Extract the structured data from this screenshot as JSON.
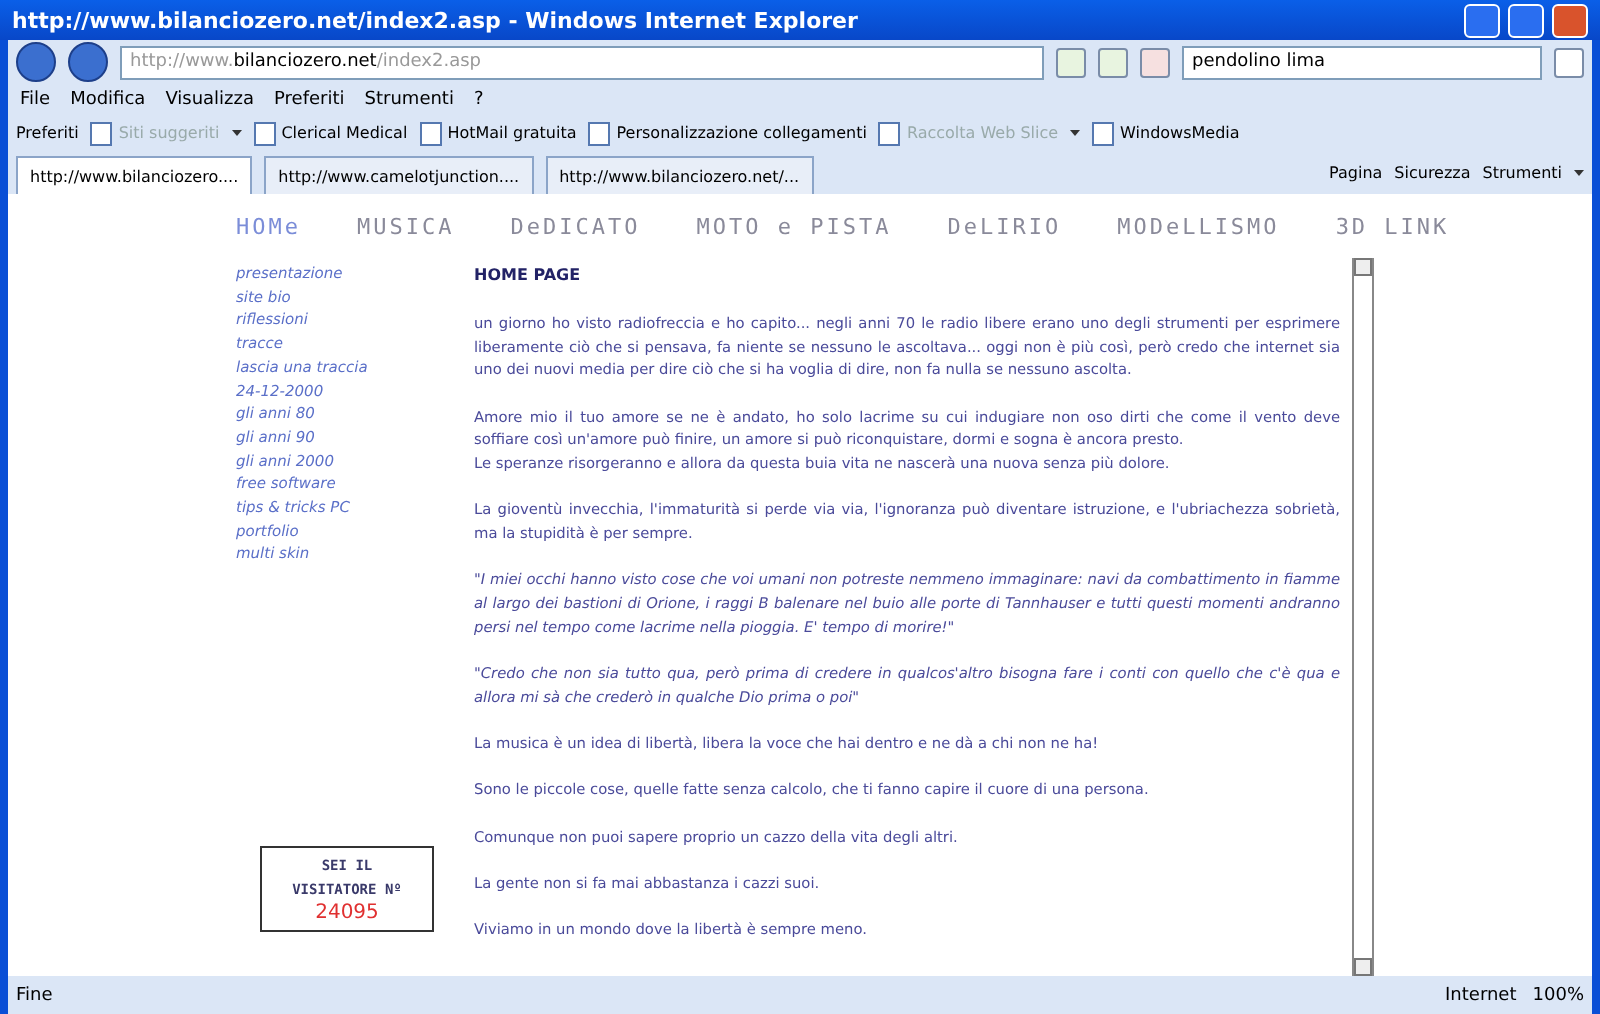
{
  "window": {
    "title": "http://www.bilanciozero.net/index2.asp - Windows Internet Explorer"
  },
  "address_bar": {
    "prefix": "http://www.",
    "domain": "bilanciozero.net",
    "path": "/index2.asp"
  },
  "search": {
    "value": "pendolino lima"
  },
  "menu": [
    "File",
    "Modifica",
    "Visualizza",
    "Preferiti",
    "Strumenti",
    "?"
  ],
  "favorites_bar": {
    "label": "Preferiti",
    "links": [
      {
        "label": "Siti suggeriti",
        "disabled": true,
        "dropdown": true
      },
      {
        "label": "Clerical Medical",
        "disabled": false,
        "dropdown": false
      },
      {
        "label": "HotMail gratuita",
        "disabled": false,
        "dropdown": false
      },
      {
        "label": "Personalizzazione collegamenti",
        "disabled": false,
        "dropdown": false
      },
      {
        "label": "Raccolta Web Slice",
        "disabled": true,
        "dropdown": true
      },
      {
        "label": "WindowsMedia",
        "disabled": false,
        "dropdown": false
      }
    ]
  },
  "tabs": [
    {
      "label": "http://www.bilanciozero....",
      "selected": true
    },
    {
      "label": "http://www.camelotjunction....",
      "selected": false
    },
    {
      "label": "http://www.bilanciozero.net/...",
      "selected": false
    }
  ],
  "command_bar": [
    "Pagina",
    "Sicurezza",
    "Strumenti"
  ],
  "page": {
    "nav": [
      {
        "label": "HOMe",
        "selected": true
      },
      {
        "label": "MUSICA",
        "selected": false
      },
      {
        "label": "DeDICATO",
        "selected": false
      },
      {
        "label": "MOTO e PISTA",
        "selected": false
      },
      {
        "label": "DeLIRIO",
        "selected": false
      },
      {
        "label": "MODeLLISMO",
        "selected": false
      },
      {
        "label": "3D LINK",
        "selected": false
      }
    ],
    "side_menu": [
      "presentazione",
      "site bio",
      "riflessioni",
      "tracce",
      "lascia una traccia",
      "24-12-2000",
      "gli anni 80",
      "gli anni 90",
      "gli anni 2000",
      "free software",
      "tips & tricks PC",
      "portfolio",
      "multi skin"
    ],
    "counter": {
      "label": "SEI IL VISITATORE Nº",
      "value": "24095"
    },
    "heading": "HOME PAGE",
    "paragraphs": [
      {
        "text": "un giorno ho visto radiofreccia e ho capito... negli anni 70 le radio libere erano uno degli strumenti per esprimere liberamente ciò che si pensava, fa niente se nessuno le ascoltava... oggi non è più così, però credo che internet sia uno dei nuovi media per dire ciò che si ha voglia di dire, non fa nulla se nessuno ascolta.",
        "italic": false
      },
      {
        "text": "Amore mio il tuo amore se ne è andato, ho solo lacrime su cui indugiare non oso dirti che come il vento deve soffiare così un'amore può finire, un amore si può riconquistare, dormi e sogna è ancora presto.",
        "italic": false
      },
      {
        "text": "Le speranze risorgeranno e allora da questa buia vita ne nascerà una nuova senza più dolore.",
        "italic": false
      },
      {
        "text": "La gioventù invecchia, l'immaturità si perde via via, l'ignoranza può diventare istruzione, e l'ubriachezza sobrietà, ma la stupidità è per sempre.",
        "italic": false
      },
      {
        "text": "\"I miei occhi hanno visto cose che voi umani non potreste nemmeno immaginare: navi da combattimento in fiamme al largo dei bastioni di Orione, i raggi B balenare nel buio alle porte di Tannhauser e tutti questi momenti andranno persi nel tempo come lacrime nella pioggia. E' tempo di morire!\"",
        "italic": true
      },
      {
        "text": "\"Credo che non sia tutto qua, però prima di credere in qualcos'altro bisogna fare i conti con quello che c'è qua e allora mi sà che crederò in qualche Dio prima o poi\"",
        "italic": true
      },
      {
        "text": "La musica è un idea di libertà, libera la voce che hai dentro e ne dà a chi non ne ha!",
        "italic": false
      },
      {
        "text": "Sono le piccole cose, quelle fatte senza calcolo, che ti fanno capire il cuore di una persona.",
        "italic": false
      },
      {
        "text": "Comunque non puoi sapere proprio un cazzo della vita degli altri.",
        "italic": false
      },
      {
        "text": "La gente non si fa mai abbastanza i cazzi suoi.",
        "italic": false
      },
      {
        "text": "Viviamo in un mondo dove la libertà è sempre meno.",
        "italic": false
      }
    ]
  },
  "status_bar": {
    "text": "Fine",
    "zone": "Internet",
    "zoom": "100%"
  }
}
